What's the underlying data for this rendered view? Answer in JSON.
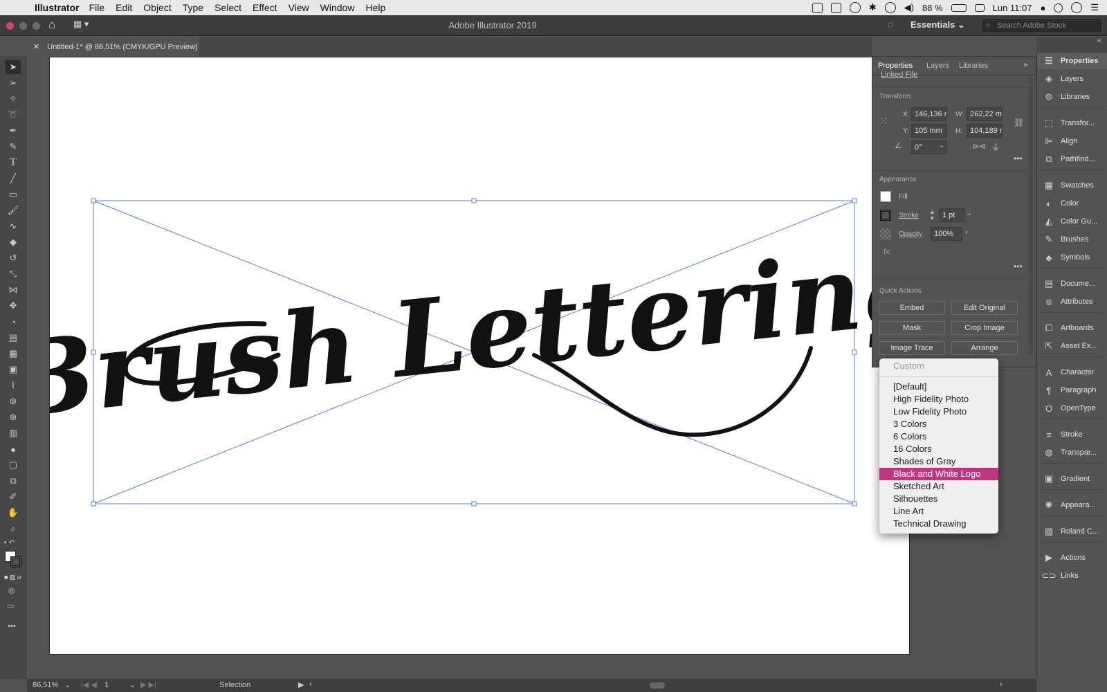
{
  "menubar": {
    "app_name": "Illustrator",
    "items": [
      "File",
      "Edit",
      "Object",
      "Type",
      "Select",
      "Effect",
      "View",
      "Window",
      "Help"
    ],
    "battery": "88 %",
    "clock": "Lun 11:07"
  },
  "titlebar": {
    "title": "Adobe Illustrator 2019",
    "workspace": "Essentials",
    "search_placeholder": "Search Adobe Stock"
  },
  "document": {
    "tab_label": "Untitled-1* @ 86,51% (CMYK/GPU Preview)",
    "artwork_text": "Brush Lettering"
  },
  "properties": {
    "tabs": [
      "Properties",
      "Layers",
      "Libraries"
    ],
    "linked_file": "Linked File",
    "transform": {
      "title": "Transform",
      "x_label": "X:",
      "x": "146,136 r",
      "y_label": "Y:",
      "y": "105 mm",
      "w_label": "W:",
      "w": "262,22 m",
      "h_label": "H:",
      "h": "104,189 r",
      "angle": "0°"
    },
    "appearance": {
      "title": "Appearance",
      "fill": "Fill",
      "stroke": "Stroke",
      "stroke_value": "1 pt",
      "opacity": "Opacity",
      "opacity_value": "100%",
      "fx": "fx."
    },
    "quick_actions": {
      "title": "Quick Actions",
      "embed": "Embed",
      "edit_original": "Edit Original",
      "mask": "Mask",
      "crop_image": "Crop Image",
      "image_trace": "Image Trace",
      "arrange": "Arrange"
    }
  },
  "trace_menu": {
    "header": "Custom",
    "items": [
      "[Default]",
      "High Fidelity Photo",
      "Low Fidelity Photo",
      "3 Colors",
      "6 Colors",
      "16 Colors",
      "Shades of Gray",
      "Black and White Logo",
      "Sketched Art",
      "Silhouettes",
      "Line Art",
      "Technical Drawing"
    ],
    "selected": "Black and White Logo"
  },
  "dock": {
    "items": [
      "Properties",
      "Layers",
      "Libraries",
      "Transfor...",
      "Align",
      "Pathfind...",
      "Swatches",
      "Color",
      "Color Gu...",
      "Brushes",
      "Symbols",
      "Docume...",
      "Attributes",
      "Artboards",
      "Asset Ex...",
      "Character",
      "Paragraph",
      "OpenType",
      "Stroke",
      "Transpar...",
      "Gradient",
      "Appeara...",
      "Roland C...",
      "Actions",
      "Links"
    ]
  },
  "statusbar": {
    "zoom": "86,51%",
    "artboard": "1",
    "tool": "Selection"
  },
  "colors": {
    "selection": "#4f7fe6",
    "menu_highlight": "#c0367e"
  }
}
